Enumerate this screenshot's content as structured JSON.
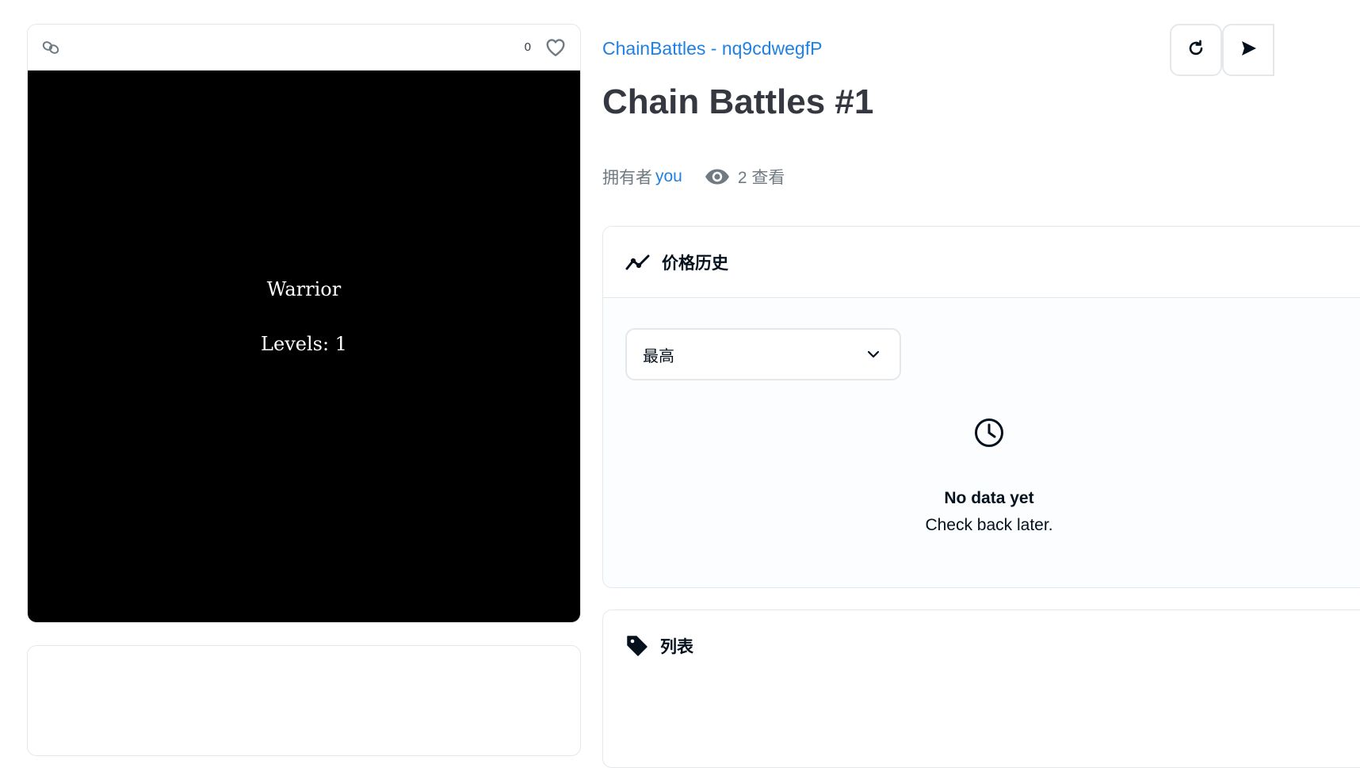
{
  "media_card": {
    "favorites_count": "0",
    "image_lines": [
      "Warrior",
      "Levels: 1"
    ]
  },
  "item": {
    "collection": "ChainBattles - nq9cdwegfP",
    "title": "Chain Battles #1",
    "owner_label": "拥有者",
    "owner_name": "you",
    "views": "2 查看"
  },
  "price_history": {
    "title": "价格历史",
    "select_value": "最高",
    "empty_title": "No data yet",
    "empty_subtitle": "Check back later."
  },
  "listings": {
    "title": "列表"
  },
  "colors": {
    "link": "#2081e2",
    "text": "#353840",
    "muted": "#707a83",
    "border": "#e5e8eb"
  }
}
